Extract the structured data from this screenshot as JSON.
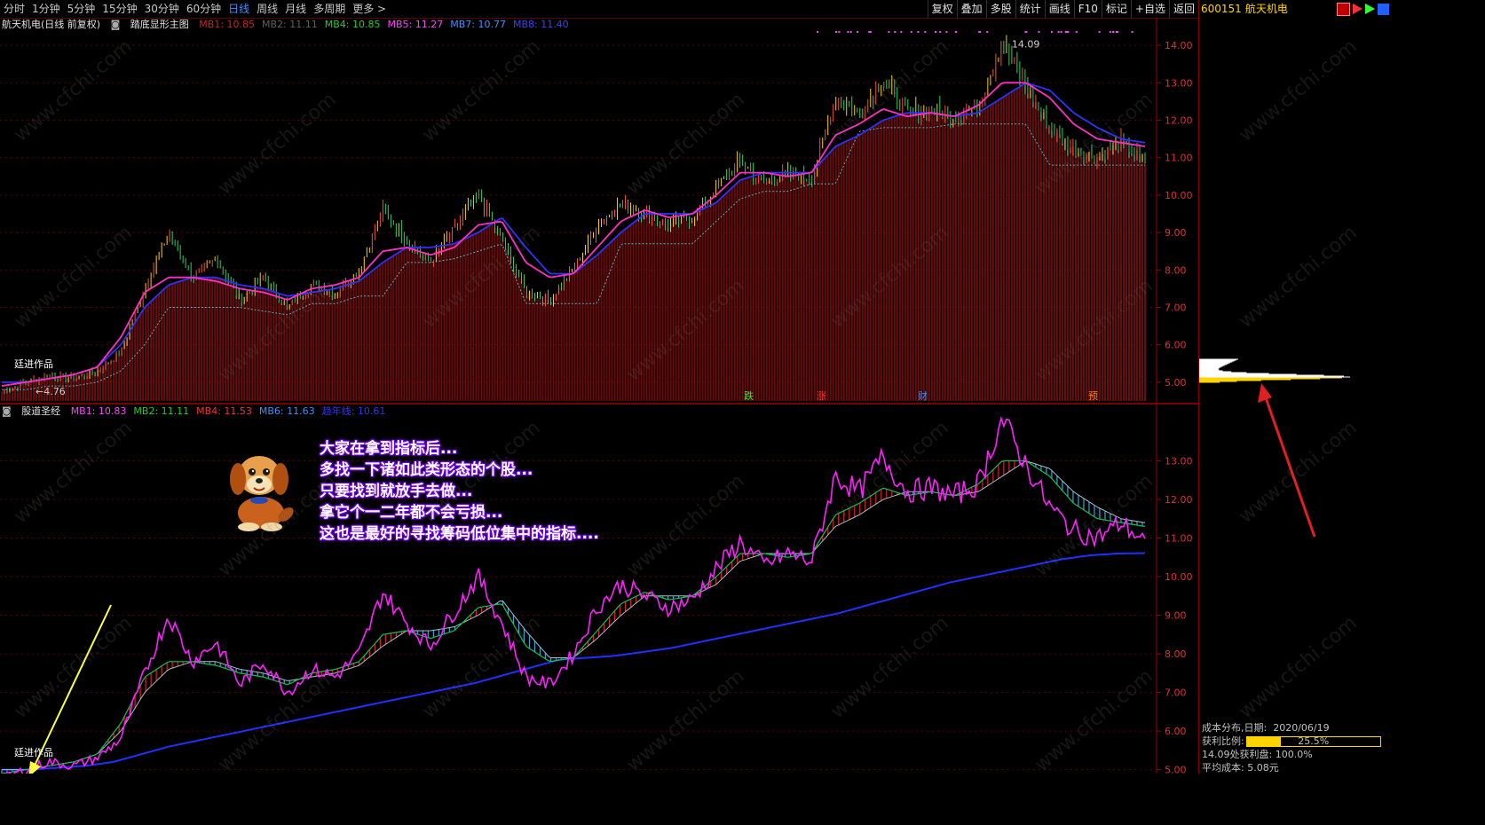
{
  "toolbar": {
    "periods": [
      "分时",
      "1分钟",
      "5分钟",
      "15分钟",
      "30分钟",
      "60分钟",
      "日线",
      "周线",
      "月线",
      "多周期",
      "更多 >"
    ],
    "active_period": "日线",
    "actions": [
      "复权",
      "叠加",
      "多股",
      "统计",
      "画线",
      "F10",
      "标记",
      "+自选",
      "返回"
    ]
  },
  "stock": {
    "code": "600151",
    "name": "航天机电"
  },
  "main_panel": {
    "title": "航天机电(日线 前复权)",
    "indicator": "踏底显形主图",
    "mas": [
      {
        "label": "MB1: 10.85",
        "color": "#d02020"
      },
      {
        "label": "MB2: 11.11",
        "color": "#606060"
      },
      {
        "label": "MB4: 10.85",
        "color": "#20d020"
      },
      {
        "label": "MB5: 11.27",
        "color": "#ff40ff"
      },
      {
        "label": "MB7: 10.77",
        "color": "#3f8fff"
      },
      {
        "label": "MB8: 11.40",
        "color": "#3f3fff"
      }
    ],
    "high_label": "14.09",
    "low_label": "4.76",
    "author": "廷进作品",
    "event_marks": [
      {
        "label": "跌",
        "color": "#20ff20"
      },
      {
        "label": "涨",
        "color": "#ff3030"
      },
      {
        "label": "财",
        "color": "#3f8fff"
      },
      {
        "label": "预",
        "color": "#ff8000"
      }
    ]
  },
  "sub_panel": {
    "title": "股道圣经",
    "mas": [
      {
        "label": "MB1: 10.83",
        "color": "#ff40ff"
      },
      {
        "label": "MB2: 11.11",
        "color": "#20d020"
      },
      {
        "label": "MB4: 11.53",
        "color": "#ff3030"
      },
      {
        "label": "MB6: 11.63",
        "color": "#3f8fff"
      },
      {
        "label": "趋年线: 10.61",
        "color": "#3030ff"
      }
    ],
    "author": "廷进作品"
  },
  "note_lines": [
    "大家在拿到指标后...",
    "多找一下诸如此类形态的个股...",
    "只要找到就放手去做...",
    "拿它个一二年都不会亏损...",
    "这也是最好的寻找筹码低位集中的指标...."
  ],
  "cost": {
    "title": "成本分布,日期:",
    "date": "2020/06/19",
    "profit_ratio_label": "获利比例:",
    "profit_ratio_pct": 25.5,
    "profit_ratio_text": "25.5%",
    "at_price_label": "14.09处获利盘:",
    "at_price_value": "100.0%",
    "avg_cost_label": "平均成本:",
    "avg_cost_value": "5.08元"
  },
  "watermark": "www.cfchi.com",
  "chart_data": {
    "type": "line",
    "main_y_ticks": [
      14.0,
      13.0,
      12.0,
      11.0,
      10.0,
      9.0,
      8.0,
      7.0,
      6.0,
      5.0
    ],
    "sub_y_ticks": [
      13.0,
      12.0,
      11.0,
      10.0,
      9.0,
      8.0,
      7.0,
      6.0,
      5.0
    ],
    "main_ylim": [
      4.5,
      14.5
    ],
    "sub_ylim": [
      4.9,
      14.0
    ],
    "close_keypoints": [
      4.76,
      5.0,
      5.2,
      5.1,
      5.3,
      5.8,
      7.5,
      9.0,
      7.8,
      8.3,
      7.2,
      7.8,
      7.0,
      7.6,
      7.4,
      8.0,
      9.6,
      8.8,
      8.2,
      9.1,
      10.0,
      8.8,
      7.4,
      7.2,
      8.0,
      9.2,
      9.8,
      9.5,
      9.2,
      9.4,
      10.2,
      10.9,
      10.3,
      10.6,
      10.4,
      12.6,
      12.2,
      13.1,
      12.2,
      12.3,
      12.1,
      12.4,
      14.09,
      12.9,
      11.8,
      11.2,
      11.0,
      11.4,
      10.9
    ],
    "ma_blue_keypoints": [
      5.0,
      5.0,
      5.1,
      5.2,
      5.4,
      6.0,
      7.0,
      7.6,
      7.8,
      7.8,
      7.6,
      7.5,
      7.3,
      7.4,
      7.5,
      7.7,
      8.2,
      8.6,
      8.6,
      8.7,
      9.0,
      9.4,
      8.6,
      7.9,
      7.9,
      8.4,
      9.0,
      9.5,
      9.5,
      9.5,
      9.8,
      10.4,
      10.6,
      10.6,
      10.6,
      11.3,
      11.6,
      12.0,
      12.2,
      12.2,
      12.1,
      12.2,
      12.6,
      13.0,
      12.8,
      12.2,
      11.8,
      11.5,
      11.4
    ],
    "ma_pink_keypoints": [
      4.9,
      5.0,
      5.1,
      5.2,
      5.4,
      6.2,
      7.4,
      7.8,
      7.8,
      7.7,
      7.5,
      7.4,
      7.2,
      7.5,
      7.6,
      7.8,
      8.5,
      8.6,
      8.4,
      8.6,
      9.2,
      9.3,
      8.2,
      7.8,
      7.9,
      8.6,
      9.3,
      9.6,
      9.4,
      9.5,
      10.0,
      10.6,
      10.6,
      10.5,
      10.6,
      11.6,
      11.9,
      12.3,
      12.1,
      12.2,
      12.1,
      12.4,
      13.0,
      13.0,
      12.6,
      11.9,
      11.5,
      11.4,
      11.3
    ],
    "support_keypoints": [
      4.8,
      4.8,
      4.9,
      4.9,
      5.0,
      5.3,
      6.0,
      7.0,
      7.0,
      7.0,
      7.0,
      6.9,
      6.8,
      7.1,
      7.1,
      7.3,
      7.3,
      8.2,
      8.2,
      8.3,
      8.5,
      8.7,
      7.1,
      7.1,
      7.1,
      7.1,
      8.7,
      8.7,
      8.7,
      8.7,
      9.3,
      9.9,
      10.1,
      10.1,
      10.3,
      10.3,
      11.7,
      11.8,
      11.8,
      11.8,
      11.9,
      11.9,
      11.9,
      11.9,
      10.8,
      10.8,
      10.8,
      10.8,
      10.8
    ],
    "trend_year_line": [
      5.0,
      5.0,
      5.05,
      5.1,
      5.2,
      5.4,
      5.6,
      5.75,
      5.9,
      6.05,
      6.2,
      6.35,
      6.5,
      6.65,
      6.8,
      6.95,
      7.1,
      7.25,
      7.45,
      7.65,
      7.85,
      7.9,
      7.95,
      8.05,
      8.15,
      8.3,
      8.45,
      8.6,
      8.75,
      8.9,
      9.05,
      9.25,
      9.45,
      9.65,
      9.85,
      10.0,
      10.15,
      10.3,
      10.45,
      10.55,
      10.6,
      10.61
    ]
  }
}
